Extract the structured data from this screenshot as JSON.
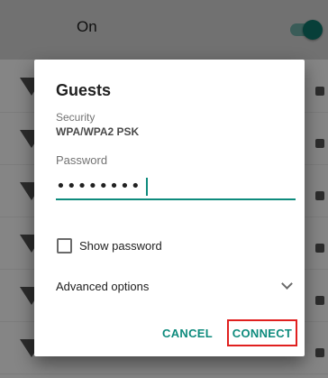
{
  "wifi_toggle": {
    "label": "On",
    "state": "on",
    "accent_color": "#0e7a6e"
  },
  "dialog": {
    "title": "Guests",
    "security_label": "Security",
    "security_value": "WPA/WPA2 PSK",
    "password_label": "Password",
    "password_value": "••••••••",
    "show_password_label": "Show password",
    "show_password_checked": false,
    "advanced_options_label": "Advanced options",
    "cancel_label": "CANCEL",
    "connect_label": "CONNECT"
  },
  "colors": {
    "accent": "#0e8b7d",
    "highlight_border": "#e0201f"
  },
  "icons": [
    "wifi-signal-icon",
    "lock-icon",
    "chevron-down-icon",
    "checkbox-icon"
  ]
}
